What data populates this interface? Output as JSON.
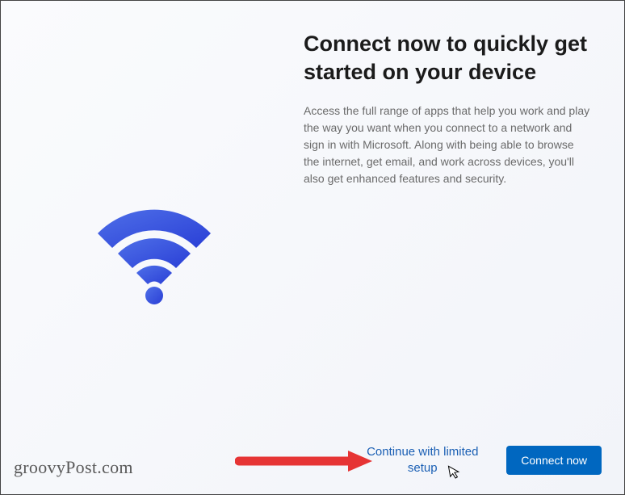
{
  "title": "Connect now to quickly get started on your device",
  "description": "Access the full range of apps that help you work and play the way you want when you connect to a network and sign in with Microsoft. Along with being able to browse the internet, get email, and work across devices, you'll also get enhanced features and security.",
  "limited_setup_label": "Continue with limited setup",
  "connect_button_label": "Connect now",
  "watermark": "groovyPost.com"
}
